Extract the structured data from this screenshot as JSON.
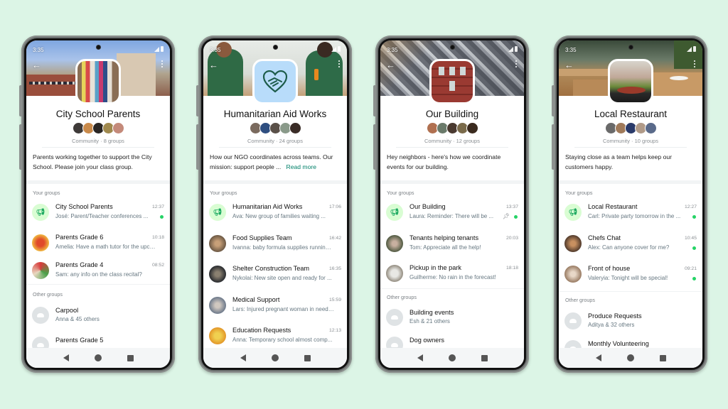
{
  "status_time": "3:35",
  "nav": {
    "back": "Back",
    "home": "Home",
    "recents": "Recents"
  },
  "phones": [
    {
      "title": "City School Parents",
      "subtitle": "Community · 8 groups",
      "description": "Parents working together to support the City School. Please join your class group.",
      "read_more": "",
      "your_groups_label": "Your groups",
      "your_groups": [
        {
          "name": "City School Parents",
          "time": "12:37",
          "message": "José: Parent/Teacher conferences ...",
          "avatar": "announcement-icon",
          "unread": true,
          "pinned": false
        },
        {
          "name": "Parents Grade 6",
          "time": "10:18",
          "message": "Amelia: Have a math tutor for the upco...",
          "avatar": "photo",
          "unread": false,
          "pinned": false
        },
        {
          "name": "Parents Grade 4",
          "time": "08:52",
          "message": "Sam: any info on the class recital?",
          "avatar": "photo",
          "unread": false,
          "pinned": false
        }
      ],
      "other_groups_label": "Other groups",
      "other_groups": [
        {
          "name": "Carpool",
          "members": "Anna & 45 others"
        },
        {
          "name": "Parents Grade 5",
          "members": ""
        }
      ]
    },
    {
      "title": "Humanitarian Aid Works",
      "subtitle": "Community · 24 groups",
      "description": "How our NGO coordinates across teams. Our mission: support people ...",
      "read_more": "Read more",
      "your_groups_label": "Your groups",
      "your_groups": [
        {
          "name": "Humanitarian Aid Works",
          "time": "17:06",
          "message": "Ava: New group of families waiting ...",
          "avatar": "announcement-icon",
          "unread": false,
          "pinned": false
        },
        {
          "name": "Food Supplies Team",
          "time": "16:42",
          "message": "Ivanna: baby formula supplies running ...",
          "avatar": "photo",
          "unread": false,
          "pinned": false
        },
        {
          "name": "Shelter Construction Team",
          "time": "16:35",
          "message": "Nykolai: New site open and ready for ...",
          "avatar": "photo",
          "unread": false,
          "pinned": false
        },
        {
          "name": "Medical Support",
          "time": "15:59",
          "message": "Lars: Injured pregnant woman in need ...",
          "avatar": "photo",
          "unread": false,
          "pinned": false
        },
        {
          "name": "Education Requests",
          "time": "12:13",
          "message": "Anna: Temporary school almost comp...",
          "avatar": "photo",
          "unread": false,
          "pinned": false
        }
      ],
      "other_groups_label": "",
      "other_groups": []
    },
    {
      "title": "Our Building",
      "subtitle": "Community · 12 groups",
      "description": "Hey neighbors - here's how we coordinate events for our building.",
      "read_more": "",
      "your_groups_label": "Your groups",
      "your_groups": [
        {
          "name": "Our Building",
          "time": "13:37",
          "message": "Laura: Reminder:  There will be ...",
          "avatar": "announcement-icon",
          "unread": true,
          "pinned": true
        },
        {
          "name": "Tenants helping tenants",
          "time": "20:03",
          "message": "Tom: Appreciate all the help!",
          "avatar": "photo",
          "unread": false,
          "pinned": false
        },
        {
          "name": "Pickup in the park",
          "time": "18:18",
          "message": "Guilherme: No rain in the forecast!",
          "avatar": "photo",
          "unread": false,
          "pinned": false
        }
      ],
      "other_groups_label": "Other groups",
      "other_groups": [
        {
          "name": "Building events",
          "members": "Esh & 21 others"
        },
        {
          "name": "Dog owners",
          "members": ""
        }
      ]
    },
    {
      "title": "Local Restaurant",
      "subtitle": "Community · 10 groups",
      "description": "Staying close as a team helps keep our customers happy.",
      "read_more": "",
      "your_groups_label": "Your groups",
      "your_groups": [
        {
          "name": "Local Restaurant",
          "time": "12:27",
          "message": "Carl: Private party tomorrow in the ...",
          "avatar": "announcement-icon",
          "unread": true,
          "pinned": false
        },
        {
          "name": "Chefs Chat",
          "time": "10:45",
          "message": "Alex: Can anyone cover for me?",
          "avatar": "photo",
          "unread": true,
          "pinned": false
        },
        {
          "name": "Front of house",
          "time": "09:21",
          "message": "Valeryia: Tonight will be special!",
          "avatar": "photo",
          "unread": true,
          "pinned": false
        }
      ],
      "other_groups_label": "Other groups",
      "other_groups": [
        {
          "name": "Produce Requests",
          "members": "Aditya & 32 others"
        },
        {
          "name": "Monthly Volunteering",
          "members": ""
        }
      ]
    }
  ],
  "colors": {
    "background": "#dcf5e6",
    "accent_green": "#25d366",
    "announcement_bg": "#d9fdd3",
    "link": "#008069"
  }
}
